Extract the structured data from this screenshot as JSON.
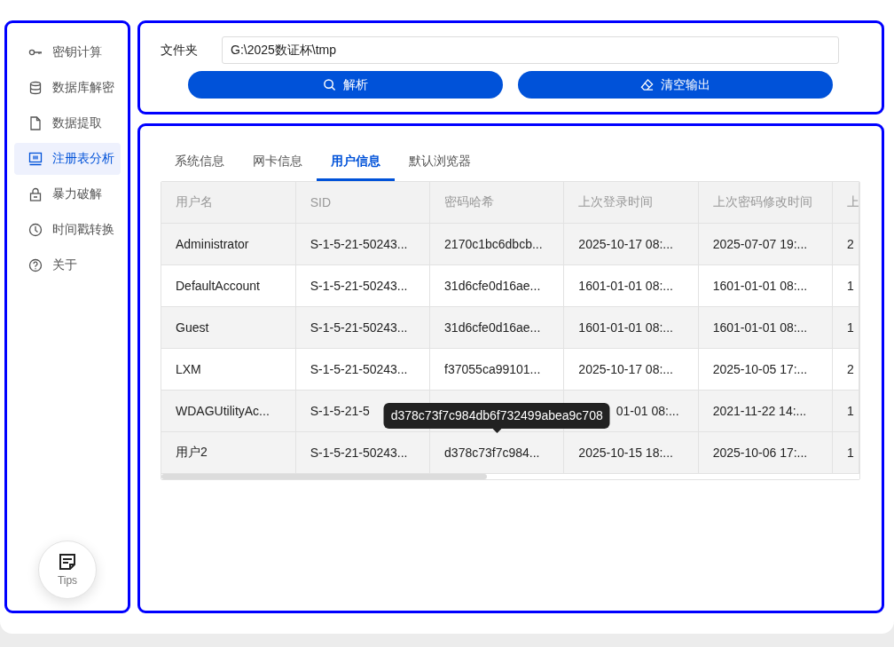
{
  "sidebar": {
    "items": [
      {
        "label": "密钥计算",
        "selected": false
      },
      {
        "label": "数据库解密",
        "selected": false
      },
      {
        "label": "数据提取",
        "selected": false
      },
      {
        "label": "注册表分析",
        "selected": true
      },
      {
        "label": "暴力破解",
        "selected": false
      },
      {
        "label": "时间戳转换",
        "selected": false
      },
      {
        "label": "关于",
        "selected": false
      }
    ],
    "tips_button": "Tips"
  },
  "folder": {
    "label": "文件夹",
    "value": "G:\\2025数证杯\\tmp"
  },
  "buttons": [
    "解析",
    "清空输出"
  ],
  "tabs": [
    {
      "label": "系统信息",
      "selected": false
    },
    {
      "label": "网卡信息",
      "selected": false
    },
    {
      "label": "用户信息",
      "selected": true
    },
    {
      "label": "默认浏览器",
      "selected": false
    }
  ],
  "table": {
    "columns": [
      "用户名",
      "SID",
      "密码哈希",
      "上次登录时间",
      "上次密码修改时间",
      "上"
    ],
    "rows": [
      {
        "cells": [
          "Administrator",
          "S-1-5-21-50243...",
          "2170c1bc6dbcb...",
          "2025-10-17 08:...",
          "2025-07-07 19:...",
          "2"
        ],
        "shaded": true
      },
      {
        "cells": [
          "DefaultAccount",
          "S-1-5-21-50243...",
          "31d6cfe0d16ae...",
          "1601-01-01 08:...",
          "1601-01-01 08:...",
          "1"
        ],
        "shaded": false
      },
      {
        "cells": [
          "Guest",
          "S-1-5-21-50243...",
          "31d6cfe0d16ae...",
          "1601-01-01 08:...",
          "1601-01-01 08:...",
          "1"
        ],
        "shaded": true
      },
      {
        "cells": [
          "LXM",
          "S-1-5-21-50243...",
          "f37055ca99101...",
          "2025-10-17 08:...",
          "2025-10-05 17:...",
          "2"
        ],
        "shaded": false
      },
      {
        "cells": [
          "WDAGUtilityAc...",
          "S-1-5-21-5",
          null,
          "01-01 08:...",
          "2021-11-22 14:...",
          "1"
        ],
        "shaded": true
      },
      {
        "cells": [
          "用户2",
          "S-1-5-21-50243...",
          "d378c73f7c984...",
          "2025-10-15 18:...",
          "2025-10-06 17:...",
          "1"
        ],
        "shaded": true,
        "tooltip": "d378c73f7c984db6f732499abea9c708"
      }
    ]
  }
}
